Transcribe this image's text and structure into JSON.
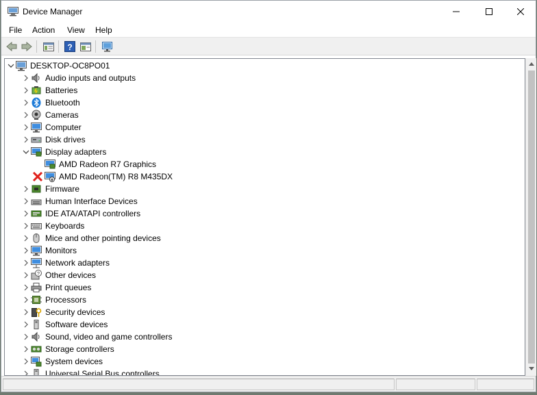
{
  "window": {
    "title": "Device Manager",
    "controls": {
      "minimize": "minimize",
      "maximize": "maximize",
      "close": "close"
    }
  },
  "menu": [
    "File",
    "Action",
    "View",
    "Help"
  ],
  "toolbar": [
    "back",
    "forward",
    "properties",
    "help",
    "update",
    "scan"
  ],
  "tree": {
    "root": "DESKTOP-OC8PO01",
    "items": [
      {
        "label": "Audio inputs and outputs",
        "icon": "speaker-icon"
      },
      {
        "label": "Batteries",
        "icon": "battery-icon"
      },
      {
        "label": "Bluetooth",
        "icon": "bluetooth-icon"
      },
      {
        "label": "Cameras",
        "icon": "camera-icon"
      },
      {
        "label": "Computer",
        "icon": "computer-icon"
      },
      {
        "label": "Disk drives",
        "icon": "disk-drive-icon"
      },
      {
        "label": "Display adapters",
        "icon": "display-adapter-icon",
        "expanded": true,
        "children": [
          {
            "label": "AMD Radeon R7 Graphics",
            "icon": "display-adapter-icon"
          },
          {
            "label": "AMD Radeon(TM) R8 M435DX",
            "icon": "display-adapter-disabled-icon",
            "flag": "error"
          }
        ]
      },
      {
        "label": "Firmware",
        "icon": "firmware-icon"
      },
      {
        "label": "Human Interface Devices",
        "icon": "hid-icon"
      },
      {
        "label": "IDE ATA/ATAPI controllers",
        "icon": "ide-controller-icon"
      },
      {
        "label": "Keyboards",
        "icon": "keyboard-icon"
      },
      {
        "label": "Mice and other pointing devices",
        "icon": "mouse-icon"
      },
      {
        "label": "Monitors",
        "icon": "monitor-icon"
      },
      {
        "label": "Network adapters",
        "icon": "network-adapter-icon"
      },
      {
        "label": "Other devices",
        "icon": "other-devices-icon"
      },
      {
        "label": "Print queues",
        "icon": "printer-icon"
      },
      {
        "label": "Processors",
        "icon": "processor-icon"
      },
      {
        "label": "Security devices",
        "icon": "security-device-icon"
      },
      {
        "label": "Software devices",
        "icon": "software-device-icon"
      },
      {
        "label": "Sound, video and game controllers",
        "icon": "sound-controller-icon"
      },
      {
        "label": "Storage controllers",
        "icon": "storage-controller-icon"
      },
      {
        "label": "System devices",
        "icon": "system-devices-icon"
      },
      {
        "label": "Universal Serial Bus controllers",
        "icon": "usb-controller-icon"
      }
    ]
  }
}
